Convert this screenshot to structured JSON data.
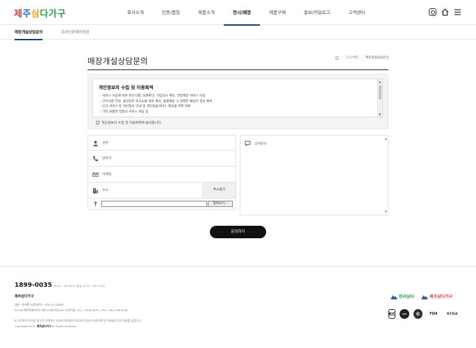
{
  "brand": {
    "logo_text": "제주삼다가구",
    "logo_colors": [
      "#e0403a",
      "#2d6bb5",
      "#f0a020",
      "#2c9a4a"
    ]
  },
  "nav": {
    "items": [
      {
        "label": "회사소개"
      },
      {
        "label": "인증/품질"
      },
      {
        "label": "제품소개"
      },
      {
        "label": "전시/매장",
        "active": true
      },
      {
        "label": "제품구매"
      },
      {
        "label": "홍보/카달로그"
      },
      {
        "label": "고객센터"
      }
    ],
    "icons": [
      "instagram-icon",
      "home-icon",
      "menu-icon"
    ]
  },
  "subnav": {
    "items": [
      {
        "label": "매장개설상담문의",
        "active": true
      },
      {
        "label": "온라인판매처정점"
      }
    ]
  },
  "page": {
    "title": "매장개설상담문의",
    "breadcrumb": [
      "전시/매장",
      "매장개설상담문의"
    ]
  },
  "privacy": {
    "heading": "개인정보의 수집 및 이용목적",
    "lines": [
      "- 서비스 이용에 따른 본인식별, 실명확인, 가입의사 확인, 연령제한 서비스 이용",
      "- 고지사항 전달, 불만처리 의사소통 경로 확보, 물품배송 시 정확한 배송지 정보 확보",
      "- 신규 서비스 등 최신정보 안내 및 개인맞춤서비스 제공을 위한 자료",
      "- 기타 원활한 양질의 서비스 제공 등"
    ],
    "agree_label": "개인정보의 수집 및 이용목적에 동의합니다."
  },
  "form": {
    "name_label": "성명",
    "phone_label": "연락처",
    "email_label": "이메일",
    "address_label": "주소",
    "address_button": "주소찾기",
    "file_button": "찾아보기...",
    "detail_label": "상세문의",
    "submit_label": "문의하기"
  },
  "footer": {
    "tel": "1899-0035",
    "hours": "09:30 ~ PM 06:00 (점심 12:00 ~ PM 13:00)",
    "company": "제주삼다가구",
    "info_lines": [
      "대표 : 손재형   사업자번호 : 616-23-42680",
      "63136 제주특별자치도 제주시 애조로길 86 (도련이동)   TEL : 1899-0035  /   FAX : 064-758-0068",
      "본 사이트의 이미지 및 모든 콘텐츠는 당사에 저작권이 있으므로 당사의 사전허락 및 계약없이 무단사용을 금합니다."
    ],
    "copyright_prefix": "Copyright 2015.",
    "copyright_brand": "제주삼다가구",
    "copyright_suffix": "all rights reserved.",
    "logos": [
      "한라삼다",
      "제주삼다가구"
    ],
    "certs": [
      "KC",
      "ISO",
      "G",
      "FDA",
      "KFDA"
    ]
  }
}
